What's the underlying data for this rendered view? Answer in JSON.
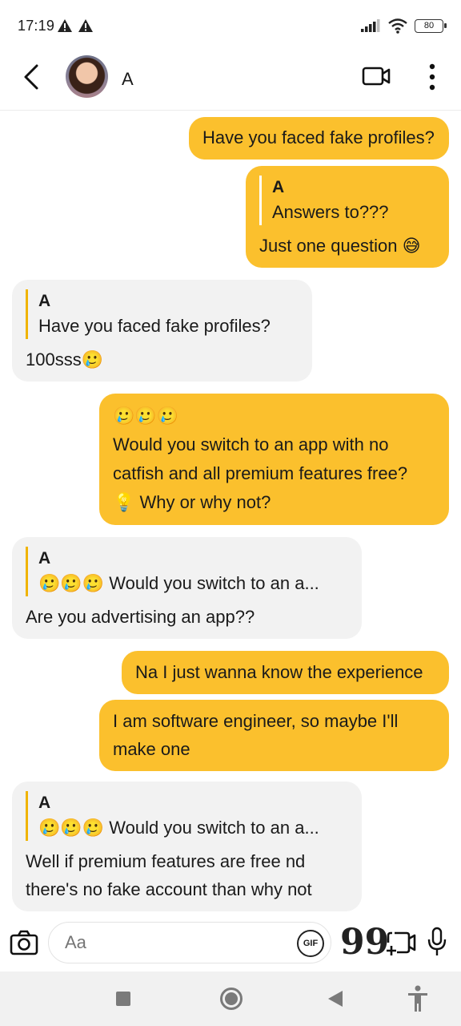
{
  "status_bar": {
    "time": "17:19",
    "battery": "80"
  },
  "header": {
    "contact_name": "A",
    "message_placeholder": "Aa",
    "gif_label": "GIF",
    "quote_symbol": "99"
  },
  "messages": [
    {
      "direction": "outgoing",
      "text": "Have you faced fake profiles?"
    },
    {
      "direction": "outgoing",
      "reply_to_name": "A",
      "reply_to_text": "Answers to???",
      "text": "Just one question 😅"
    },
    {
      "direction": "incoming",
      "reply_to_name": "A",
      "reply_to_text": "Have you faced fake profiles?",
      "text": "100sss🥲"
    },
    {
      "direction": "outgoing",
      "line1": "🥲🥲🥲",
      "line2": "Would you switch to an app with no",
      "line3": "catfish and all premium features free?",
      "line4": "💡 Why or why not?"
    },
    {
      "direction": "incoming",
      "reply_to_name": "A",
      "reply_to_text": "🥲🥲🥲 Would you switch to an a...",
      "text": "Are you advertising an app??"
    },
    {
      "direction": "outgoing",
      "text": "Na I just wanna know the experience"
    },
    {
      "direction": "outgoing",
      "line1": "I am software engineer, so maybe I'll",
      "line2": "make one"
    },
    {
      "direction": "incoming",
      "reply_to_name": "A",
      "reply_to_text": "🥲🥲🥲 Would you switch to an a...",
      "line1": "Well if premium features are free nd",
      "line2": "there's no fake account than why not"
    }
  ],
  "colors": {
    "outgoing_bubble": "#fbc02d",
    "incoming_bubble": "#f2f2f2",
    "quote_bar": "#f0b400"
  },
  "icons": [
    "back-arrow-icon",
    "video-call-icon",
    "more-vertical-icon",
    "camera-icon",
    "gif-icon",
    "quote-icon",
    "video-add-icon",
    "mic-icon"
  ]
}
